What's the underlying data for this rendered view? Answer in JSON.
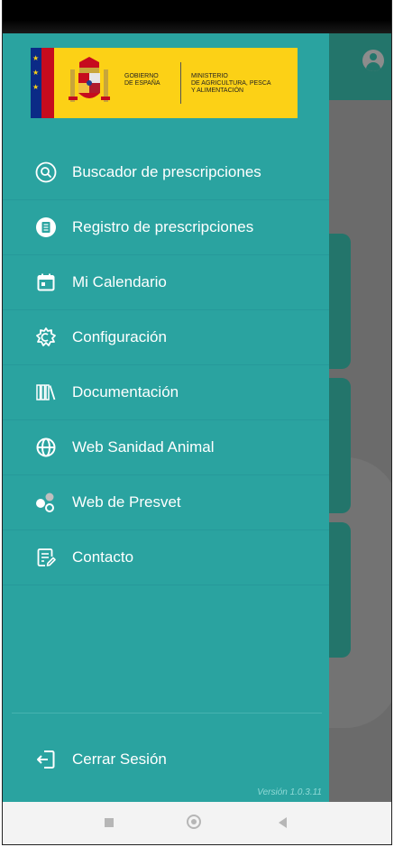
{
  "logo": {
    "gov_line1": "GOBIERNO",
    "gov_line2": "DE ESPAÑA",
    "min_line1": "MINISTERIO",
    "min_line2": "DE AGRICULTURA, PESCA",
    "min_line3": "Y ALIMENTACIÓN"
  },
  "menu": {
    "items": [
      {
        "label": "Buscador de prescripciones",
        "icon": "search-icon"
      },
      {
        "label": "Registro de prescripciones",
        "icon": "document-list-icon"
      },
      {
        "label": "Mi Calendario",
        "icon": "calendar-icon"
      },
      {
        "label": "Configuración",
        "icon": "settings-icon"
      },
      {
        "label": "Documentación",
        "icon": "library-icon"
      },
      {
        "label": "Web Sanidad Animal",
        "icon": "globe-icon"
      },
      {
        "label": "Web de Presvet",
        "icon": "presvet-icon"
      },
      {
        "label": "Contacto",
        "icon": "contact-form-icon"
      }
    ]
  },
  "logout": {
    "label": "Cerrar Sesión",
    "icon": "logout-icon"
  },
  "version": "Versión 1.0.3.11",
  "colors": {
    "drawer": "#2aa3a0",
    "topbar_dimmed": "#23756b",
    "logo_yellow": "#fcd116"
  }
}
